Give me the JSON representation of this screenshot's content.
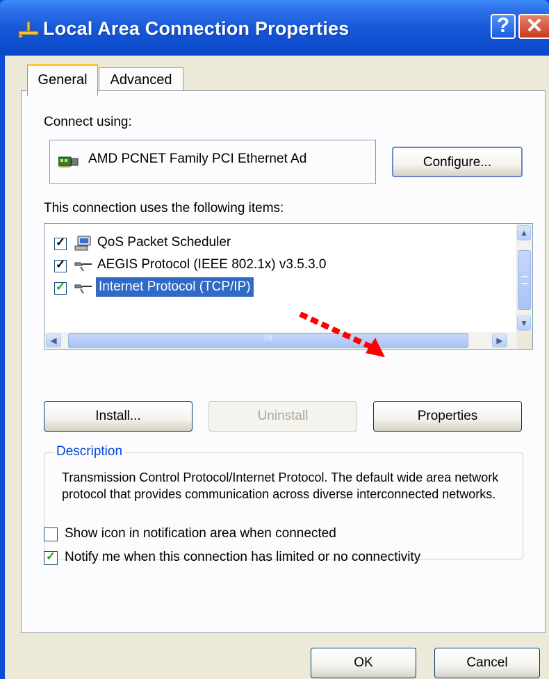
{
  "window": {
    "title": "Local Area Connection Properties",
    "help_glyph": "?",
    "close_glyph": "✕"
  },
  "tabs": [
    {
      "label": "General",
      "selected": true
    },
    {
      "label": "Advanced",
      "selected": false
    }
  ],
  "general": {
    "connect_using_label": "Connect using:",
    "adapter_name": "AMD PCNET Family PCI Ethernet Ad",
    "configure_label": "Configure...",
    "items_label": "This connection uses the following items:",
    "items": [
      {
        "label": "QoS Packet Scheduler",
        "checked": true,
        "icon": "qos-scheduler-icon"
      },
      {
        "label": "AEGIS Protocol (IEEE 802.1x) v3.5.3.0",
        "checked": true,
        "icon": "network-protocol-icon"
      },
      {
        "label": "Internet Protocol (TCP/IP)",
        "checked": true,
        "icon": "network-protocol-icon",
        "selected": true
      }
    ],
    "hscroll_grip": "IIII",
    "install_label": "Install...",
    "uninstall_label": "Uninstall",
    "properties_label": "Properties",
    "description_title": "Description",
    "description_text": "Transmission Control Protocol/Internet Protocol. The default wide area network protocol that provides communication across diverse interconnected networks.",
    "show_icon_label": "Show icon in notification area when connected",
    "show_icon_checked": false,
    "notify_label": "Notify me when this connection has limited or no connectivity",
    "notify_checked": true
  },
  "footer": {
    "ok_label": "OK",
    "cancel_label": "Cancel"
  },
  "colors": {
    "titlebar": "#0a4fd6",
    "selection": "#316ac5",
    "annotation_arrow": "#ff0000",
    "dialog_bg": "#ece9d8"
  }
}
